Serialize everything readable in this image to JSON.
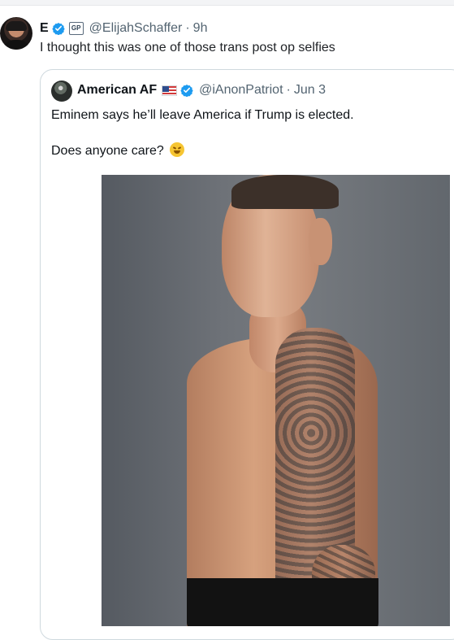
{
  "tweet": {
    "name": "E",
    "verified_icon": "verified-check-icon",
    "badge_text": "GP",
    "handle": "@ElijahSchaffer",
    "separator": "·",
    "time": "9h",
    "text": "I thought this was one of those trans post op selfies"
  },
  "quote": {
    "name": "American AF",
    "flag_icon": "us-flag-icon",
    "verified_icon": "verified-check-icon",
    "handle": "@iAnonPatriot",
    "separator": "·",
    "date": "Jun 3",
    "text_line_1": "Eminem says he’ll leave America if Trump is elected.",
    "text_line_2": "Does anyone care?",
    "emoji": "face-with-tears-of-joy-icon",
    "image_icon": "shirtless-man-photo"
  },
  "colors": {
    "verified_blue": "#1d9bf0",
    "secondary_text": "#536471",
    "border": "#cfd9de",
    "background": "#ffffff"
  }
}
